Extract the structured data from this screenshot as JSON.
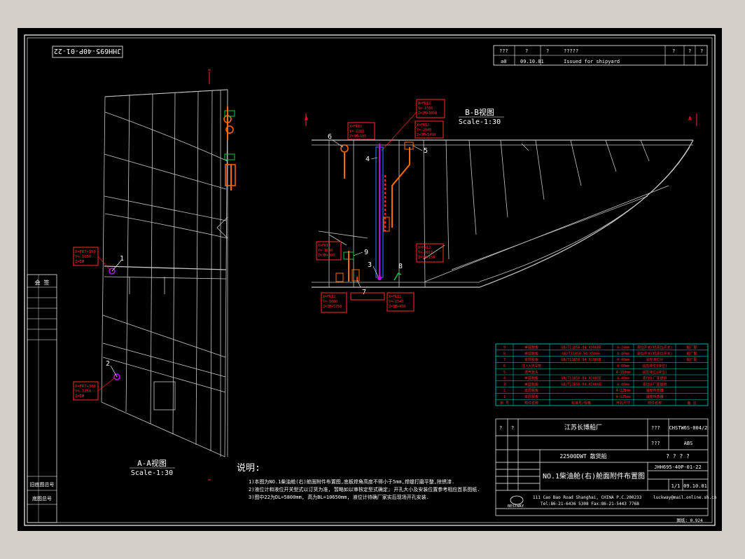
{
  "drawing_number_rotated": "JHH695-40P-01-22",
  "revision_block": {
    "header": [
      "???",
      "?",
      "?",
      "?????",
      "?",
      "?",
      "?"
    ],
    "row": [
      "a0",
      "",
      "09.10.01",
      "Issued for shipyard",
      "",
      "",
      ""
    ]
  },
  "views": {
    "aa_title": "A-A视图",
    "aa_scale": "Scale-1:30",
    "bb_title": "B-B视图",
    "bb_scale": "Scale-1:30",
    "section_mark": "A"
  },
  "callouts": {
    "c1": "1",
    "c2": "2",
    "c3": "3",
    "c4": "4",
    "c5": "5",
    "c6": "6",
    "c7": "7",
    "c8": "8",
    "c9": "9"
  },
  "left_strip": {
    "label1": "会 签",
    "label2": "旧底图总号",
    "label3": "底图总号"
  },
  "notes": {
    "title": "说明:",
    "line1": "1)本图为NO.1柴油舱(右)舱面附件布置图,底板焊角高度不得小于5mm,焊缝打磨平整,除锈漆.",
    "line2": "2)液位计和液位开关型式以订货为准, 暂略如以审核定型式确定; 开孔大小及安装位置参考相应首系图纸.",
    "line3": "3)图中22为DL=5800mm, 高为BL=10650mm, 液位计待确厂家实后现场开孔安装."
  },
  "parts_table": {
    "rows": [
      [
        "9",
        "单层脱板",
        "GB/T11850-94 X3068E",
        "4-24mm",
        "液位开关(机液位开关)",
        "船厂配"
      ],
      [
        "8",
        "单层脱板",
        "GB/T11850-94 X5066",
        "4-40mm",
        "液位开关(机液位开关)",
        "船厂配"
      ],
      [
        "7",
        "单层脱板",
        "GB/T11850-94 X1086E",
        "4-40mm",
        "遥控液位计",
        "船厂配"
      ],
      [
        "6",
        "注入+测深管",
        "",
        "4-80mm",
        "遥控液位(液位)",
        ""
      ],
      [
        "5",
        "透气管头",
        "",
        "4-150mm",
        "遥控液位(液位)",
        ""
      ],
      [
        "4",
        "单层脱板",
        "GB/T11850-94 X1085E",
        "4-40mm",
        "液位计厂家提供",
        ""
      ],
      [
        "3",
        "单层脱板",
        "GB/T11850-94 X1080E",
        "4-40mm",
        "液位计厂家提供",
        ""
      ],
      [
        "2",
        "单层脱板",
        "",
        "4-125mm",
        "温度传感器",
        ""
      ],
      [
        "1",
        "单层脱板",
        "",
        "4-125mm",
        "温度传感器",
        ""
      ]
    ],
    "header": [
      "序 号",
      "构件名称",
      "标准号/规格",
      "开孔尺寸",
      "附件名称",
      "备 注"
    ]
  },
  "title_block": {
    "q1": "?",
    "q2": "?",
    "shipyard": "江苏长博船厂",
    "q3": "???",
    "drawing_code": "CHSTW6S-004/2",
    "q4": "???",
    "class": "ABS",
    "ship": "22500DWT 散货船",
    "qs": "? ? ? ?",
    "drawing_title": "NO.1柴油舱(右)舱面附件布置图",
    "drawing_no": "JHH695-40P-01-22",
    "sheet": "1/1",
    "date": "09.10.01",
    "company": "BESTWAY",
    "address": "111 Cao Bao Road Shanghai, CHINA   P.C.200233",
    "tel": "Tel:86-21-6436 5308   Fax:86-21-5443 7768",
    "email": "luckway@mail.online.sh.cn",
    "scale_note": "图纸: 0.924"
  },
  "red_labels": {
    "l1": [
      "X=FR7+150",
      "Y=-1600",
      "Z=5M"
    ],
    "l2": [
      "X=FR7+300",
      "Y=-7250",
      "Z=5M"
    ],
    "l4": [
      "X=FR12",
      "Y=-2040",
      "Z=3M+1450"
    ],
    "l5": [
      "X=FR12",
      "Y=-1560",
      "Z=3M+3050"
    ],
    "l6": [
      "X=FR12",
      "Y=-2283",
      "Z=3M+105"
    ],
    "l3": [
      "X=FR12",
      "Y=-2017",
      "Z=3M+150"
    ],
    "l7": [
      "X=FR12",
      "Y=-1600",
      "Z=3M+5758"
    ],
    "l8": [
      "X=FR12",
      "Y=-1540",
      "Z=3M+400"
    ],
    "l9": [
      "X=FR12",
      "Y=-1600",
      "Z=3M+300"
    ]
  }
}
